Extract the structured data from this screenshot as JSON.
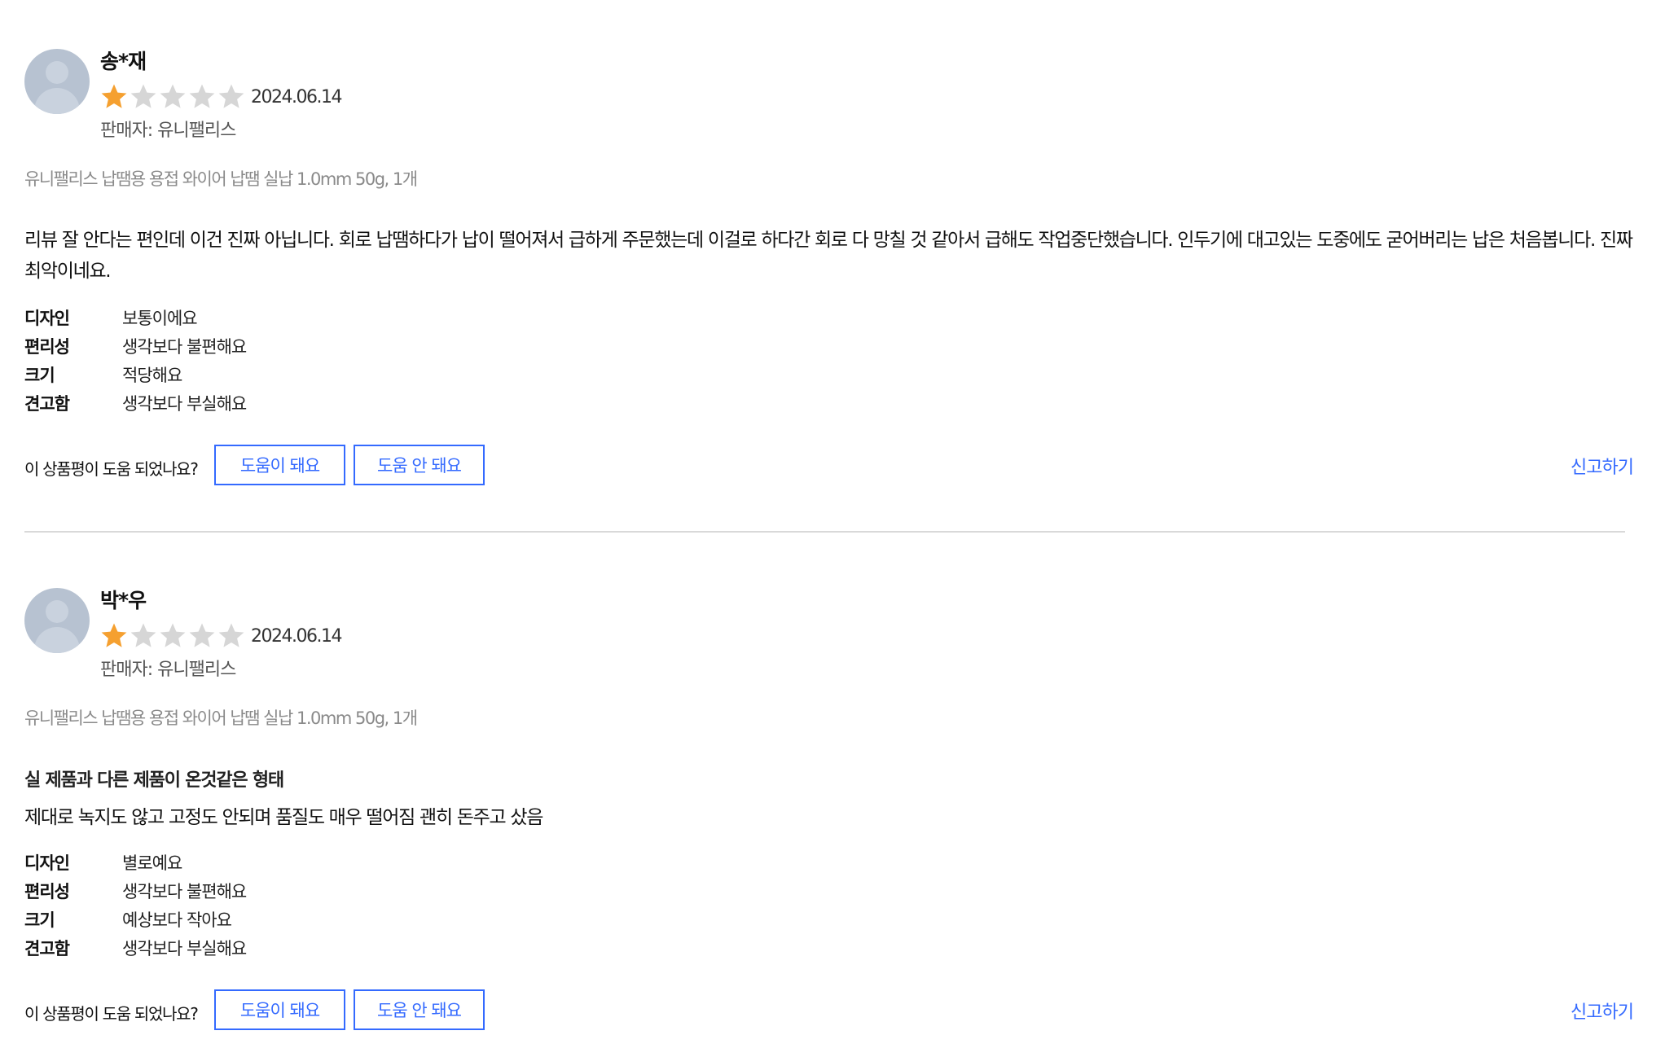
{
  "colors": {
    "accent": "#346aff",
    "star_filled": "#f5a030",
    "star_empty": "#d6d6d6",
    "avatar": "#b7c2d1",
    "divider": "#d9d9d9"
  },
  "reviews": [
    {
      "name": "송*재",
      "rating": 1,
      "max_rating": 5,
      "date": "2024.06.14",
      "seller": "판매자: 유니팰리스",
      "product": "유니팰리스 납땜용 용접 와이어 납땜 실납 1.0mm 50g, 1개",
      "title": "",
      "content": "리뷰 잘 안다는 편인데 이건 진짜 아닙니다. 회로 납땜하다가 납이 떨어져서 급하게 주문했는데 이걸로 하다간 회로 다 망칠 것 같아서 급해도 작업중단했습니다. 인두기에 대고있는 도중에도 굳어버리는 납은 처음봅니다. 진짜 최악이네요.",
      "attributes": [
        {
          "label": "디자인",
          "value": "보통이에요"
        },
        {
          "label": "편리성",
          "value": "생각보다 불편해요"
        },
        {
          "label": "크기",
          "value": "적당해요"
        },
        {
          "label": "견고함",
          "value": "생각보다 부실해요"
        }
      ],
      "helpful_question": "이 상품평이 도움 되었나요?",
      "helpful_yes": "도움이 돼요",
      "helpful_no": "도움 안 돼요",
      "report": "신고하기"
    },
    {
      "name": "박*우",
      "rating": 1,
      "max_rating": 5,
      "date": "2024.06.14",
      "seller": "판매자: 유니팰리스",
      "product": "유니팰리스 납땜용 용접 와이어 납땜 실납 1.0mm 50g, 1개",
      "title": "실 제품과 다른 제품이 온것같은 형태",
      "content": "제대로 녹지도 않고 고정도 안되며 품질도 매우 떨어짐 괜히 돈주고 샀음",
      "attributes": [
        {
          "label": "디자인",
          "value": "별로예요"
        },
        {
          "label": "편리성",
          "value": "생각보다 불편해요"
        },
        {
          "label": "크기",
          "value": "예상보다 작아요"
        },
        {
          "label": "견고함",
          "value": "생각보다 부실해요"
        }
      ],
      "helpful_question": "이 상품평이 도움 되었나요?",
      "helpful_yes": "도움이 돼요",
      "helpful_no": "도움 안 돼요",
      "report": "신고하기"
    }
  ]
}
